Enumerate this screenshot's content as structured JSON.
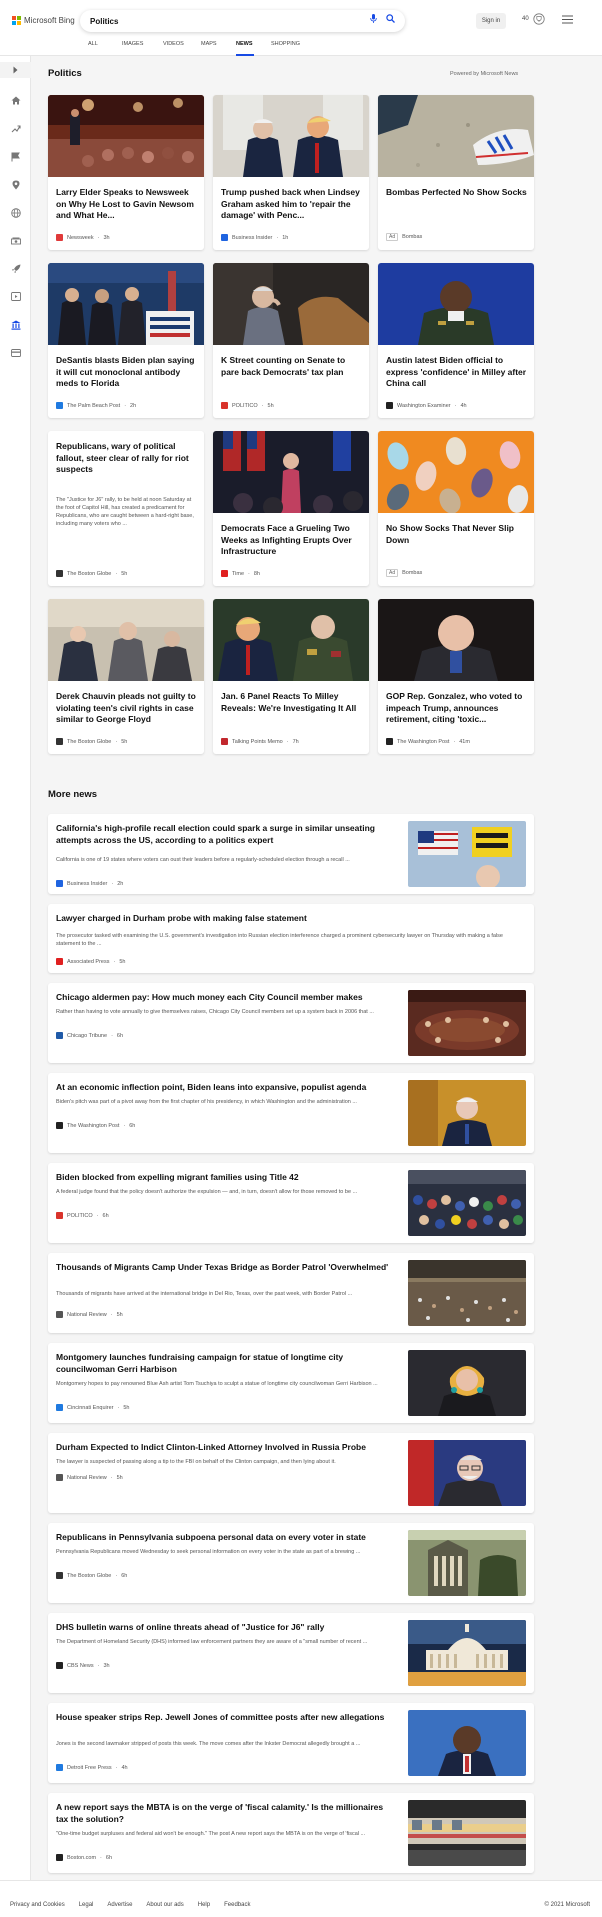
{
  "header": {
    "brand": "Microsoft Bing",
    "search_value": "Politics",
    "signin_label": "Sign in",
    "points": "40",
    "tabs": [
      "ALL",
      "IMAGES",
      "VIDEOS",
      "MAPS",
      "NEWS",
      "SHOPPING"
    ],
    "active_tab": "NEWS"
  },
  "main": {
    "section_title": "Politics",
    "powered_by": "Powered by Microsoft News",
    "cards": [
      {
        "title": "Larry Elder Speaks to Newsweek on Why He Lost to Gavin Newsom and What He...",
        "source": "Newsweek",
        "time": "3h",
        "src_color": "#e03a3a"
      },
      {
        "title": "Trump pushed back when Lindsey Graham asked him to 'repair the damage' with Penc...",
        "source": "Business Insider",
        "time": "1h",
        "src_color": "#1f64e0"
      },
      {
        "title": "Bombas Perfected No Show Socks",
        "source": "Bombas",
        "ad_label": "Ad",
        "src_color": ""
      },
      {
        "title": "DeSantis blasts Biden plan saying it will cut monoclonal antibody meds to Florida",
        "source": "The Palm Beach Post",
        "time": "2h",
        "src_color": "#1f7ae0"
      },
      {
        "title": "K Street counting on Senate to pare back Democrats' tax plan",
        "source": "POLITICO",
        "time": "5h",
        "src_color": "#d9332b"
      },
      {
        "title": "Austin latest Biden official to express 'confidence' in Milley after China call",
        "source": "Washington Examiner",
        "time": "4h",
        "src_color": "#222222"
      },
      {
        "title": "Republicans, wary of political fallout, steer clear of rally for riot suspects",
        "snippet": "The \"Justice for J6\" rally, to be held at noon Saturday at the foot of Capitol Hill, has created a predicament for Republicans, who are caught between a hard-right base, including many voters who ...",
        "source": "The Boston Globe",
        "time": "5h",
        "src_color": "#333333"
      },
      {
        "title": "Democrats Face a Grueling Two Weeks as Infighting Erupts Over Infrastructure",
        "source": "Time",
        "time": "8h",
        "src_color": "#e02020"
      },
      {
        "title": "No Show Socks That Never Slip Down",
        "source": "Bombas",
        "ad_label": "Ad",
        "src_color": ""
      },
      {
        "title": "Derek Chauvin pleads not guilty to violating teen's civil rights in case similar to George Floyd",
        "source": "The Boston Globe",
        "time": "5h",
        "src_color": "#333333"
      },
      {
        "title": "Jan. 6 Panel Reacts To Milley Reveals: We're Investigating It All",
        "source": "Talking Points Memo",
        "time": "7h",
        "src_color": "#c2272d"
      },
      {
        "title": "GOP Rep. Gonzalez, who voted to impeach Trump, announces retirement, citing 'toxic...",
        "source": "The Washington Post",
        "time": "41m",
        "src_color": "#222222"
      }
    ],
    "more_news_title": "More news",
    "more_news": [
      {
        "title": "California's high-profile recall election could spark a surge in similar unseating attempts across the US, according to a politics expert",
        "snippet": "California is one of 19 states where voters can oust their leaders before a regularly-scheduled election through a recall ...",
        "source": "Business Insider",
        "time": "2h",
        "src_color": "#1f64e0"
      },
      {
        "title": "Lawyer charged in Durham probe with making false statement",
        "snippet": "The prosecutor tasked with examining the U.S. government's investigation into Russian election interference charged a prominent cybersecurity lawyer on Thursday with making a false statement to the ...",
        "source": "Associated Press",
        "time": "5h",
        "src_color": "#e02020"
      },
      {
        "title": "Chicago aldermen pay: How much money each City Council member makes",
        "snippet": "Rather than having to vote annually to give themselves raises, Chicago City Council members set up a system back in 2006 that ...",
        "source": "Chicago Tribune",
        "time": "6h",
        "src_color": "#1f5aa8"
      },
      {
        "title": "At an economic inflection point, Biden leans into expansive, populist agenda",
        "snippet": "Biden's pitch was part of a pivot away from the first chapter of his presidency, in which Washington and the administration ...",
        "source": "The Washington Post",
        "time": "6h",
        "src_color": "#222222"
      },
      {
        "title": "Biden blocked from expelling migrant families using Title 42",
        "snippet": "A federal judge found that the policy doesn't authorize the expulsion — and, in turn, doesn't allow for those removed to be ...",
        "source": "POLITICO",
        "time": "6h",
        "src_color": "#d9332b"
      },
      {
        "title": "Thousands of Migrants Camp Under Texas Bridge as Border Patrol 'Overwhelmed'",
        "snippet": "Thousands of migrants have arrived at the international bridge in Del Rio, Texas, over the past week, with Border Patrol ...",
        "source": "National Review",
        "time": "5h",
        "src_color": "#555555"
      },
      {
        "title": "Montgomery launches fundraising campaign for statue of longtime city councilwoman Gerri Harbison",
        "snippet": "Montgomery hopes to pay renowned Blue Ash artist Tom Tsuchiya to sculpt a statue of longtime city councilwoman Gerri Harbison ...",
        "source": "Cincinnati Enquirer",
        "time": "5h",
        "src_color": "#1f7ae0"
      },
      {
        "title": "Durham Expected to Indict Clinton-Linked Attorney Involved in Russia Probe",
        "snippet": "The lawyer is suspected of passing along a tip to the FBI on behalf of the Clinton campaign, and then lying about it.",
        "source": "National Review",
        "time": "5h",
        "src_color": "#555555"
      },
      {
        "title": "Republicans in Pennsylvania subpoena personal data on every voter in state",
        "snippet": "Pennsylvania Republicans moved Wednesday to seek personal information on every voter in the state as part of a brewing ...",
        "source": "The Boston Globe",
        "time": "6h",
        "src_color": "#333333"
      },
      {
        "title": "DHS bulletin warns of online threats ahead of \"Justice for J6\" rally",
        "snippet": "The Department of Homeland Security (DHS) informed law enforcement partners they are aware of a \"small number of recent ...",
        "source": "CBS News",
        "time": "3h",
        "src_color": "#222222"
      },
      {
        "title": "House speaker strips Rep. Jewell Jones of committee posts after new allegations",
        "snippet": "Jones is the second lawmaker stripped of posts this week. The move comes after the Inkster Democrat allegedly brought a ...",
        "source": "Detroit Free Press",
        "time": "4h",
        "src_color": "#1f7ae0"
      },
      {
        "title": "A new report says the MBTA is on the verge of 'fiscal calamity.' Is the millionaires tax the solution?",
        "snippet": "\"One-time budget surpluses and federal aid won't be enough.\" The post A new report says the MBTA is on the verge of 'fiscal ...",
        "source": "Boston.com",
        "time": "6h",
        "src_color": "#222222"
      }
    ]
  },
  "footer": {
    "links": [
      "Privacy and Cookies",
      "Legal",
      "Advertise",
      "About our ads",
      "Help",
      "Feedback"
    ],
    "copyright": "© 2021 Microsoft"
  }
}
